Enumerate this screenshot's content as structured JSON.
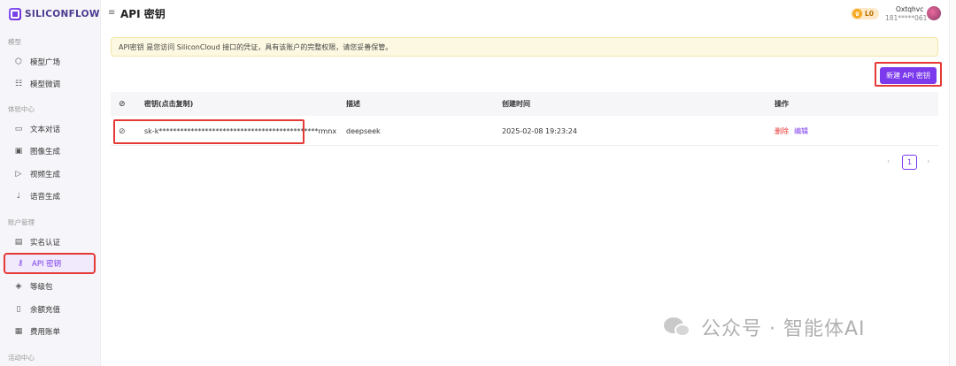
{
  "app": {
    "logo_text": "SILICONFLOW"
  },
  "sidebar": {
    "sections": [
      "模型",
      "体验中心",
      "账户管理",
      "活动中心"
    ],
    "items": [
      {
        "label": "模型广场",
        "icon": "cube-icon"
      },
      {
        "label": "模型微调",
        "icon": "sliders-icon"
      },
      {
        "label": "文本对话",
        "icon": "chat-icon"
      },
      {
        "label": "图像生成",
        "icon": "image-icon"
      },
      {
        "label": "视频生成",
        "icon": "video-icon"
      },
      {
        "label": "语音生成",
        "icon": "mic-icon"
      },
      {
        "label": "实名认证",
        "icon": "id-card-icon"
      },
      {
        "label": "API 密钥",
        "icon": "key-icon",
        "active": true
      },
      {
        "label": "等级包",
        "icon": "package-icon"
      },
      {
        "label": "余额充值",
        "icon": "wallet-icon"
      },
      {
        "label": "费用账单",
        "icon": "bill-icon"
      }
    ]
  },
  "header": {
    "title": "API 密钥",
    "level_badge": "L0",
    "user_name": "Oxtqhvc",
    "user_phone": "181*****061"
  },
  "notice": "API密钥 是您访问 SiliconCloud 接口的凭证，具有该账户的完整权限，请您妥善保管。",
  "new_key_button": "新建 API 密钥",
  "table": {
    "columns": [
      "密钥(点击复制)",
      "描述",
      "创建时间",
      "操作"
    ],
    "rows": [
      {
        "key": "sk-k*********************************************rmnx",
        "description": "deepseek",
        "created": "2025-02-08 19:23:24",
        "actions": [
          "删除",
          "编辑"
        ]
      }
    ]
  },
  "pagination": {
    "current": "1"
  },
  "watermark": "公众号 · 智能体AI",
  "colors": {
    "accent": "#7c3aed",
    "highlight": "#e53935",
    "notice_bg": "#fdf8e1"
  }
}
